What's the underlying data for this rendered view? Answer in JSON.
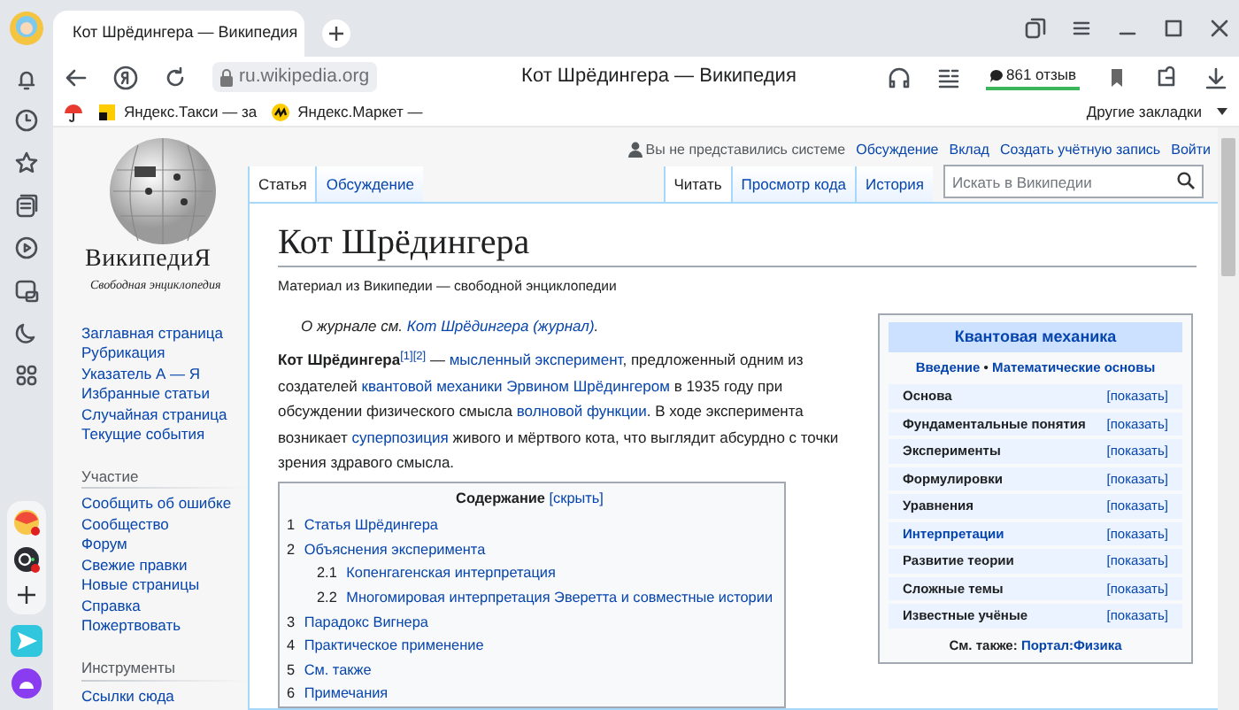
{
  "browser": {
    "tab_title": "Кот Шрёдингера — Википедия",
    "url": "ru.wikipedia.org",
    "page_title": "Кот Шрёдингера — Википедия",
    "reviews": "861 отзыв",
    "bookmarks": [
      {
        "label": "Яндекс.Такси — за",
        "kind": "taxi"
      },
      {
        "label": "Яндекс.Маркет —",
        "kind": "market"
      }
    ],
    "other_bookmarks": "Другие закладки"
  },
  "wiki": {
    "logo_title": "ВикипедиЯ",
    "logo_subtitle": "Свободная энциклопедия",
    "nav": [
      {
        "items": [
          "Заглавная страница",
          "Рубрикация",
          "Указатель А — Я",
          "Избранные статьи",
          "Случайная страница",
          "Текущие события"
        ]
      },
      {
        "heading": "Участие",
        "items": [
          "Сообщить об ошибке",
          "Сообщество",
          "Форум",
          "Свежие правки",
          "Новые страницы",
          "Справка",
          "Пожертвовать"
        ]
      },
      {
        "heading": "Инструменты",
        "items": [
          "Ссылки сюда"
        ]
      }
    ],
    "personal": [
      {
        "label": "Вы не представились системе",
        "kind": "user"
      },
      {
        "label": "Обсуждение",
        "kind": "link"
      },
      {
        "label": "Вклад",
        "kind": "link"
      },
      {
        "label": "Создать учётную запись",
        "kind": "link"
      },
      {
        "label": "Войти",
        "kind": "link"
      }
    ],
    "namespace_tabs": [
      {
        "label": "Статья",
        "selected": true
      },
      {
        "label": "Обсуждение",
        "selected": false
      }
    ],
    "view_tabs": [
      {
        "label": "Читать",
        "selected": true
      },
      {
        "label": "Просмотр кода",
        "selected": false
      },
      {
        "label": "История",
        "selected": false
      }
    ],
    "search": {
      "placeholder": "Искать в Википедии"
    },
    "title": "Кот Шрёдингера",
    "subtitle": "Материал из Википедии — свободной энциклопедии",
    "hatnote": [
      {
        "text": "О журнале см. ",
        "kind": "plain"
      },
      {
        "text": "Кот Шрёдингера (журнал)",
        "kind": "link"
      },
      {
        "text": ".",
        "kind": "plain"
      }
    ],
    "intro": [
      {
        "text": "Кот Шрёдингера",
        "kind": "bold"
      },
      {
        "text": "[1][2]",
        "kind": "sup"
      },
      {
        "text": " — ",
        "kind": "plain"
      },
      {
        "text": "мысленный эксперимент",
        "kind": "link"
      },
      {
        "text": ", предложенный одним из создателей ",
        "kind": "plain"
      },
      {
        "text": "квантовой механики",
        "kind": "link"
      },
      {
        "text": "Эрвином Шрёдингером",
        "kind": "link"
      },
      {
        "text": " в 1935 году при обсуждении физического смысла ",
        "kind": "plain"
      },
      {
        "text": "волновой функции",
        "kind": "link"
      },
      {
        "text": ". В ходе эксперимента возникает ",
        "kind": "plain"
      },
      {
        "text": "суперпозиция",
        "kind": "link"
      },
      {
        "text": " живого и мёртвого кота, что выглядит абсурдно с точки зрения здравого смысла.",
        "kind": "plain"
      }
    ],
    "toc": {
      "title": "Содержание",
      "toggle": "[скрыть]",
      "items": [
        {
          "number": "1",
          "label": "Статья Шрёдингера"
        },
        {
          "number": "2",
          "label": "Объяснения эксперимента",
          "children": [
            {
              "number": "2.1",
              "label": "Копенгагенская интерпретация"
            },
            {
              "number": "2.2",
              "label": "Многомировая интерпретация Эверетта и совместные истории"
            }
          ]
        },
        {
          "number": "3",
          "label": "Парадокс Вигнера"
        },
        {
          "number": "4",
          "label": "Практическое применение"
        },
        {
          "number": "5",
          "label": "См. также"
        },
        {
          "number": "6",
          "label": "Примечания"
        }
      ]
    },
    "infobox": {
      "title": "Квантовая механика",
      "links": [
        "Введение",
        "Математические основы"
      ],
      "links_separator": "•",
      "rows": [
        {
          "label": "Основа",
          "link": false,
          "action": "[показать]"
        },
        {
          "label": "Фундаментальные понятия",
          "link": false,
          "action": "[показать]"
        },
        {
          "label": "Эксперименты",
          "link": false,
          "action": "[показать]"
        },
        {
          "label": "Формулировки",
          "link": false,
          "action": "[показать]"
        },
        {
          "label": "Уравнения",
          "link": false,
          "action": "[показать]"
        },
        {
          "label": "Интерпретации",
          "link": true,
          "action": "[показать]"
        },
        {
          "label": "Развитие теории",
          "link": false,
          "action": "[показать]"
        },
        {
          "label": "Сложные темы",
          "link": false,
          "action": "[показать]"
        },
        {
          "label": "Известные учёные",
          "link": false,
          "action": "[показать]"
        }
      ],
      "footer_label": "См. также:",
      "footer_link": "Портал:Физика"
    }
  }
}
